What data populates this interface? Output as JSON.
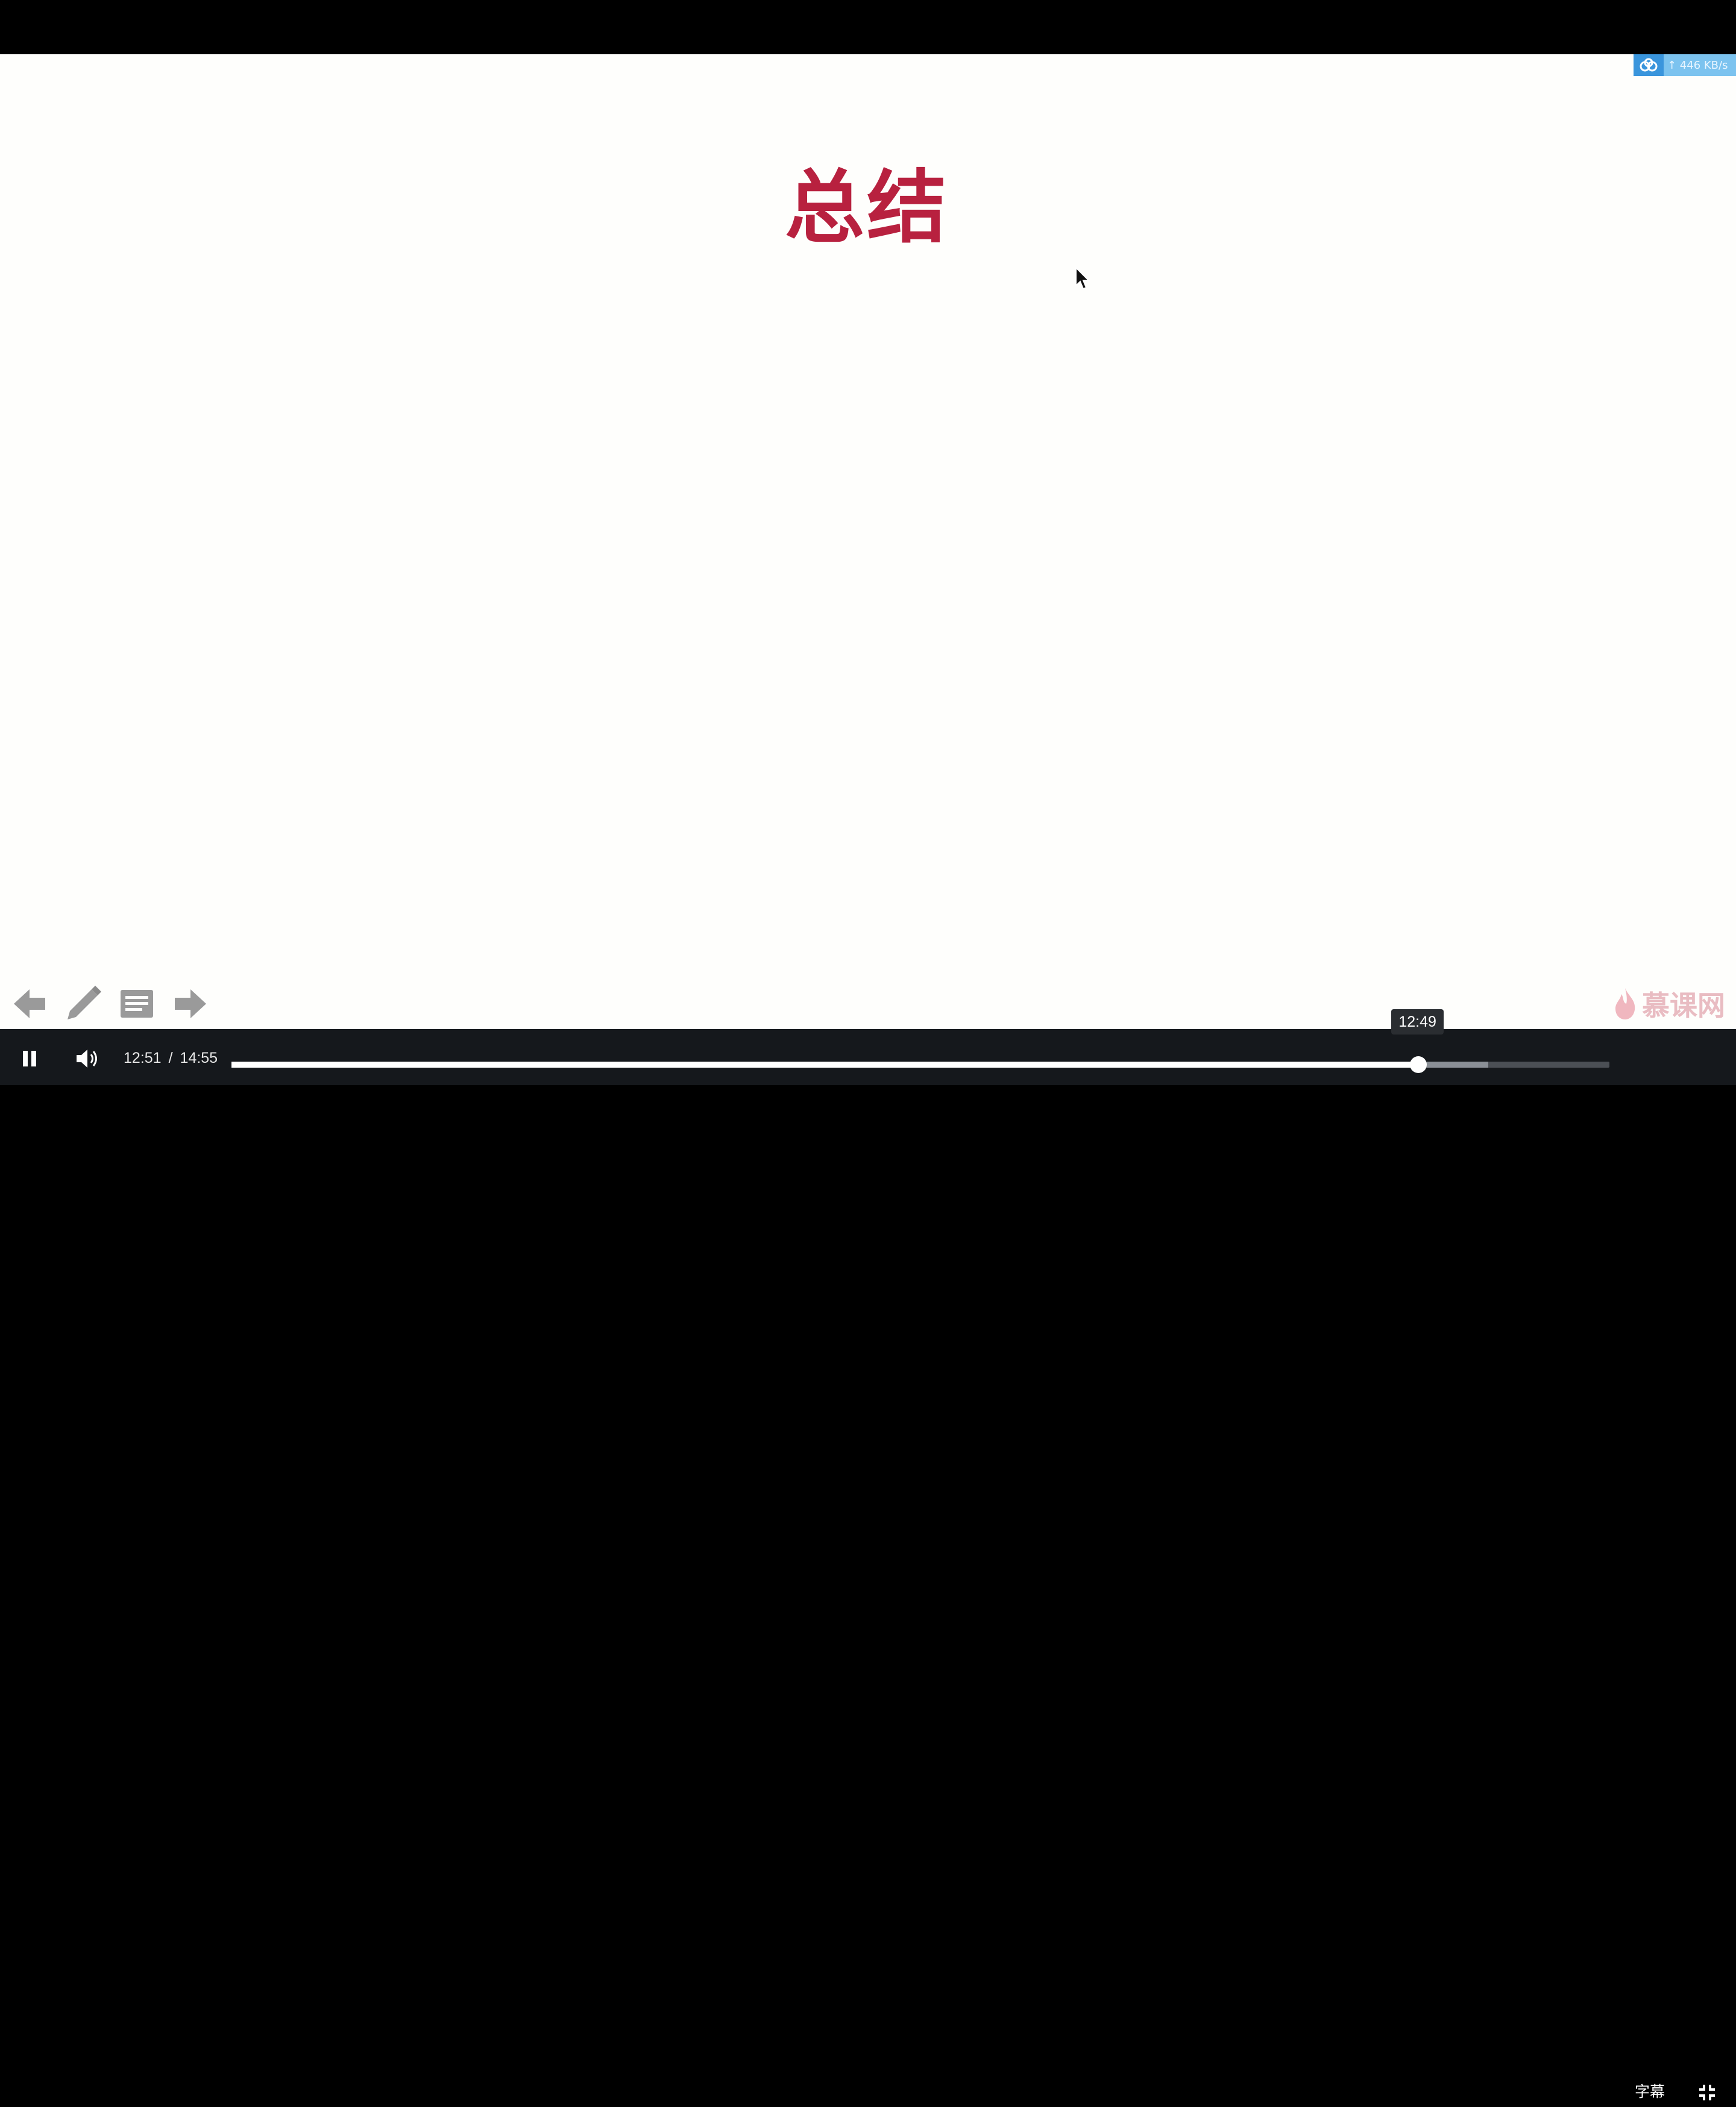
{
  "slide": {
    "title": "总结",
    "title_color": "#b8213f"
  },
  "speed_widget": {
    "icon": "cloud-accelerate-icon",
    "speed": "↑ 446 KB/s"
  },
  "slide_tools": {
    "prev_icon": "arrow-left-icon",
    "pen_icon": "pencil-icon",
    "notes_icon": "notes-icon",
    "next_icon": "arrow-right-icon"
  },
  "brand": {
    "name": "慕课网",
    "icon": "flame-icon"
  },
  "player": {
    "current_time": "12:51",
    "separator": "/",
    "duration": "14:55",
    "progress_fraction": 0.8615,
    "buffered_fraction": 0.912,
    "hover_fraction": 0.8615,
    "hover_time": "12:49",
    "subtitle_label": "字幕",
    "play_state_icon": "pause-icon",
    "volume_icon": "volume-icon",
    "fullscreen_icon": "exit-fullscreen-icon",
    "accent": "#ffffff",
    "background": "#15181c"
  }
}
